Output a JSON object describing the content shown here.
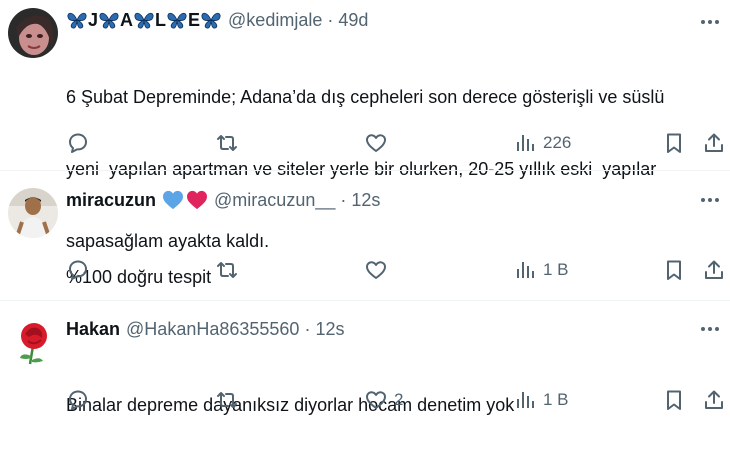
{
  "tweets": [
    {
      "display_name_letters": [
        "J",
        "A",
        "L",
        "E"
      ],
      "handle": "@kedimjale",
      "time": "49d",
      "lines": [
        "6 Şubat Depreminde; Adana’da dış cepheleri son derece gösterişli ve süslü",
        "yeni  yapılan apartman ve siteler yerle bir olurken, 20-25 yıllık eski  yapılar",
        "sapasağlam ayakta kaldı."
      ],
      "views": "226",
      "likes": ""
    },
    {
      "display_name": "miracuzun",
      "handle": "@miracuzun__",
      "time": "12s",
      "lines": [
        "%100 doğru tespit"
      ],
      "views": "1 B",
      "likes": ""
    },
    {
      "display_name": "Hakan",
      "handle": "@HakanHa86355560",
      "time": "12s",
      "lines": [
        "Binalar depreme dayanıksız diyorlar hocam denetim yok"
      ],
      "views": "1 B",
      "likes": "2"
    }
  ],
  "separator": "·",
  "colors": {
    "text": "#0f1419",
    "muted": "#536471",
    "divider": "#eff3f4",
    "butterfly": "#2b6cb0",
    "heart_blue": "#5ba4e6",
    "heart_red": "#e0245e"
  },
  "icons": {
    "more": "more-icon",
    "reply": "reply-icon",
    "retweet": "retweet-icon",
    "like": "heart-icon",
    "views": "views-icon",
    "bookmark": "bookmark-icon",
    "share": "share-icon"
  }
}
